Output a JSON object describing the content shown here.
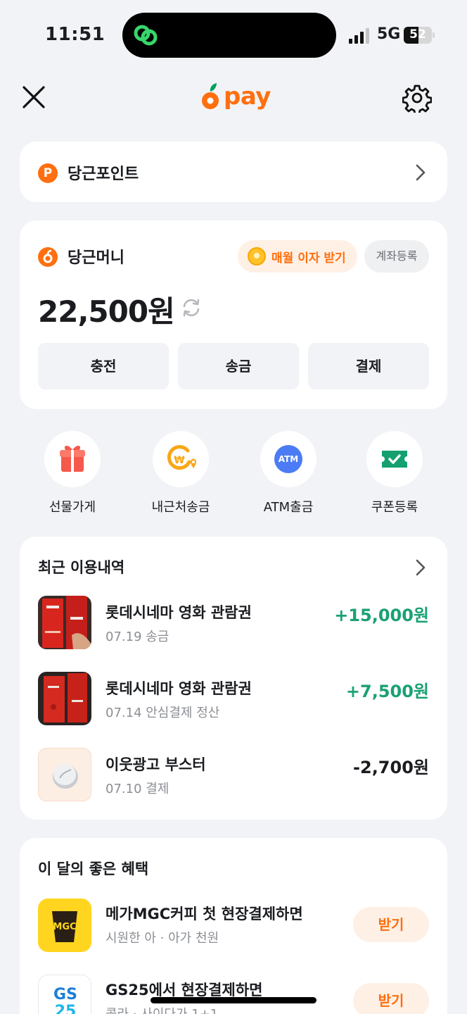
{
  "status_bar": {
    "time": "11:51",
    "network": "5G",
    "battery": "52",
    "battery_level": 0.52
  },
  "nav": {
    "logo_text": "pay",
    "brand_color": "#ff6f0f"
  },
  "points_card": {
    "icon_letter": "P",
    "label": "당근포인트"
  },
  "money_card": {
    "label": "당근머니",
    "interest_button": "매월 이자 받기",
    "account_button": "계좌등록",
    "balance": "22,500원",
    "actions": [
      "충전",
      "송금",
      "결제"
    ]
  },
  "quick_actions": [
    {
      "label": "선물가게",
      "icon": "gift-icon"
    },
    {
      "label": "내근처송금",
      "icon": "nearby-transfer-icon"
    },
    {
      "label": "ATM출금",
      "icon": "atm-icon",
      "badge": "ATM"
    },
    {
      "label": "쿠폰등록",
      "icon": "coupon-icon"
    }
  ],
  "recent": {
    "title": "최근 이용내역",
    "items": [
      {
        "title": "롯데시네마 영화 관람권",
        "subtitle": "07.19 송금",
        "amount": "+15,000원",
        "positive": true
      },
      {
        "title": "롯데시네마 영화 관람권",
        "subtitle": "07.14 안심결제 정산",
        "amount": "+7,500원",
        "positive": true
      },
      {
        "title": "이웃광고 부스터",
        "subtitle": "07.10 결제",
        "amount": "-2,700원",
        "positive": false
      }
    ]
  },
  "benefits": {
    "title": "이 달의 좋은 혜택",
    "items": [
      {
        "title": "메가MGC커피 첫 현장결제하면",
        "subtitle": "시원한 아 · 아가 천원",
        "button": "받기",
        "logo": "MGC"
      },
      {
        "title": "GS25에서 현장결제하면",
        "subtitle": "콜라 · 사이다가 1+1",
        "button": "받기",
        "logo": "GS25"
      }
    ]
  },
  "colors": {
    "positive": "#1aa174",
    "accent": "#ff6f0f",
    "background": "#f2f3f6"
  }
}
